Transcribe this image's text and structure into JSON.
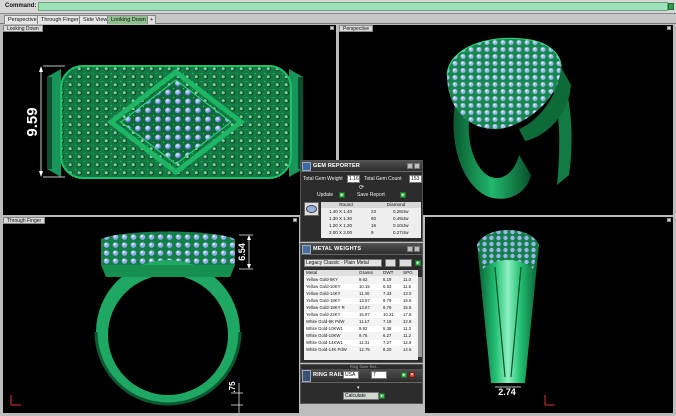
{
  "command": {
    "label": "Command:",
    "value": ""
  },
  "tabs": [
    {
      "label": "Perspective",
      "active": false
    },
    {
      "label": "Through Finger",
      "active": false
    },
    {
      "label": "Side View",
      "active": false
    },
    {
      "label": "Looking Down",
      "active": true
    },
    {
      "label": "+",
      "active": false
    }
  ],
  "viewports": {
    "top_left": {
      "title": "Looking Down",
      "dimension": "9.59"
    },
    "top_right": {
      "title": "Perspective"
    },
    "bottom_left": {
      "title": "Through Finger",
      "dimension_top": "6.54",
      "dimension_bottom": ".75"
    },
    "bottom_right": {
      "title": "",
      "dimension": "2.74"
    }
  },
  "gem_reporter": {
    "title": "GEM REPORTER",
    "total_weight_label": "Total Gem Weight",
    "total_weight": "1.16",
    "total_count_label": "Total Gem Count",
    "total_count": "153",
    "update_label": "Update",
    "save_label": "Save Report",
    "table_headers": [
      "Round",
      "Diamond"
    ],
    "rows": [
      {
        "size": "1.40 X 1.40",
        "count": "23",
        "weight": "0.28ctw"
      },
      {
        "size": "1.30 X 1.30",
        "count": "60",
        "weight": "0.49ctw"
      },
      {
        "size": "1.20 X 1.20",
        "count": "16",
        "weight": "0.10ctw"
      },
      {
        "size": "2.00 X 2.00",
        "count": "9",
        "weight": "0.27ctw"
      }
    ]
  },
  "metal_weights": {
    "title": "METAL WEIGHTS",
    "dropdown": "Legacy Classic - Plain Metal",
    "columns": [
      "Metal",
      "Grams",
      "DWT",
      "SPG"
    ],
    "rows": [
      [
        "Yellow Gold-8KY",
        "9.62",
        "6.19",
        "11.0"
      ],
      [
        "Yellow Gold-10KY",
        "10.15",
        "6.53",
        "11.6"
      ],
      [
        "Yellow Gold-14KY",
        "11.40",
        "7.33",
        "13.0"
      ],
      [
        "Yellow Gold-18KY",
        "13.67",
        "8.79",
        "15.6"
      ],
      [
        "Yellow Gold-18KY R",
        "13.67",
        "8.79",
        "15.6"
      ],
      [
        "Yellow Gold-22KY",
        "15.87",
        "10.21",
        "17.8"
      ],
      [
        "White Gold-9K PdW",
        "11.17",
        "7.18",
        "12.8"
      ],
      [
        "White Gold-10KW1",
        "9.92",
        "6.38",
        "11.3"
      ],
      [
        "White Gold-10KW",
        "9.75",
        "6.27",
        "11.2"
      ],
      [
        "White Gold-14KW1",
        "11.31",
        "7.27",
        "12.9"
      ],
      [
        "White Gold-14K PdW",
        "12.75",
        "8.20",
        "14.6"
      ]
    ],
    "footer_hint": "Ring Sizer Ref..."
  },
  "ring_rail": {
    "title": "RING RAIL",
    "region": "USA",
    "size": "7",
    "calculate_label": "Calculate"
  }
}
